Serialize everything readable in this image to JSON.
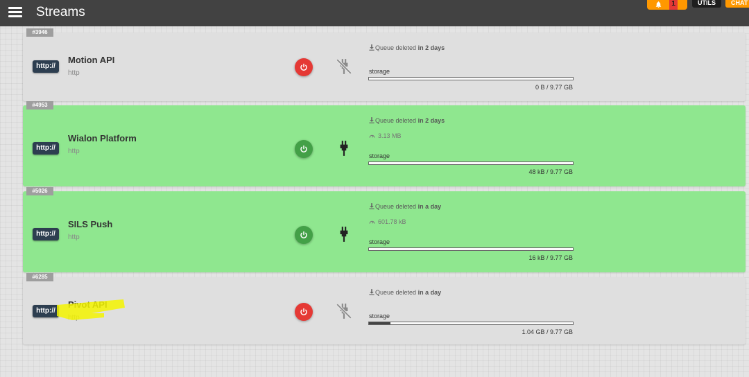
{
  "header": {
    "title": "Streams",
    "notification_count": "1",
    "utils_label": "UTILS",
    "chat_label": "CHAT"
  },
  "streams": [
    {
      "id": "#3946",
      "badge": "http://",
      "name": "Motion API",
      "protocol": "http",
      "enabled": false,
      "connected": false,
      "queue_prefix": "Queue deleted",
      "queue_when": "in 2 days",
      "rate": "",
      "storage_label": "storage",
      "storage_used": "0 B / 9.77 GB",
      "storage_fraction": 0.0
    },
    {
      "id": "#4953",
      "badge": "http://",
      "name": "Wialon Platform",
      "protocol": "http",
      "enabled": true,
      "connected": true,
      "queue_prefix": "Queue deleted",
      "queue_when": "in 2 days",
      "rate": "3.13 MB",
      "storage_label": "storage",
      "storage_used": "48 kB / 9.77 GB",
      "storage_fraction": 0.0
    },
    {
      "id": "#5026",
      "badge": "http://",
      "name": "SILS Push",
      "protocol": "http",
      "enabled": true,
      "connected": true,
      "queue_prefix": "Queue deleted",
      "queue_when": "in a day",
      "rate": "601.78 kB",
      "storage_label": "storage",
      "storage_used": "16 kB / 9.77 GB",
      "storage_fraction": 0.0
    },
    {
      "id": "#6285",
      "badge": "http://",
      "name": "Pivot API",
      "protocol": "http",
      "enabled": false,
      "connected": false,
      "queue_prefix": "Queue deleted",
      "queue_when": "in a day",
      "rate": "",
      "storage_label": "storage",
      "storage_used": "1.04 GB / 9.77 GB",
      "storage_fraction": 0.106
    }
  ],
  "colors": {
    "topbar": "#424242",
    "active_card": "#8fe78f",
    "inactive_card": "#dfdfdf",
    "power_on": "#43a047",
    "power_off": "#e53935",
    "accent": "#ff9800",
    "http_badge": "#2d3e50",
    "highlight": "#f5f500"
  },
  "icons": {
    "menu": "hamburger-menu-icon",
    "bell": "bell-icon",
    "power": "power-icon",
    "plug_connected": "plug-icon",
    "plug_disconnected": "plug-off-icon",
    "download": "download-icon",
    "speed": "gauge-icon"
  }
}
